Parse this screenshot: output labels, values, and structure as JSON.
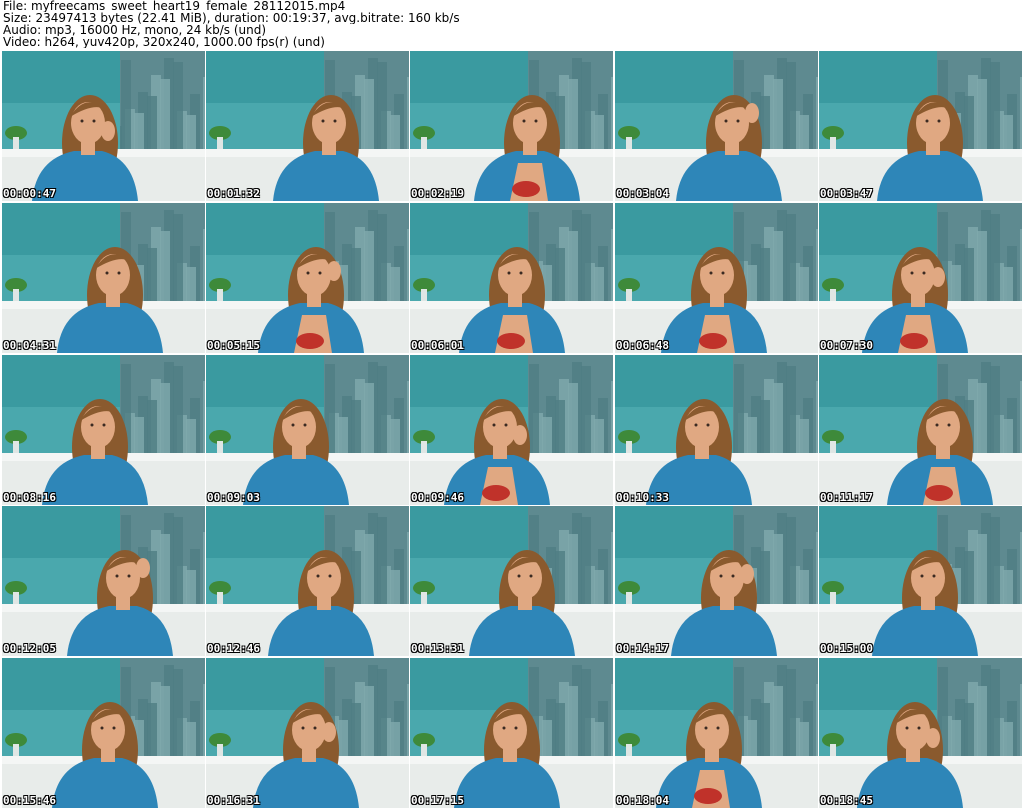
{
  "header": {
    "file_line": "File: myfreecams_sweet_heart19_female_28112015.mp4",
    "size_line": "Size: 23497413 bytes (22.41 MiB), duration: 00:19:37, avg.bitrate: 160 kb/s",
    "audio_line": "Audio: mp3, 16000 Hz, mono, 24 kb/s (und)",
    "video_line": "Video: h264, yuv420p, 320x240, 1000.00 fps(r) (und)"
  },
  "thumbnails": [
    {
      "timestamp": "00:00:47"
    },
    {
      "timestamp": "00:01:32"
    },
    {
      "timestamp": "00:02:19"
    },
    {
      "timestamp": "00:03:04"
    },
    {
      "timestamp": "00:03:47"
    },
    {
      "timestamp": "00:04:31"
    },
    {
      "timestamp": "00:05:15"
    },
    {
      "timestamp": "00:06:01"
    },
    {
      "timestamp": "00:06:48"
    },
    {
      "timestamp": "00:07:30"
    },
    {
      "timestamp": "00:08:16"
    },
    {
      "timestamp": "00:09:03"
    },
    {
      "timestamp": "00:09:46"
    },
    {
      "timestamp": "00:10:33"
    },
    {
      "timestamp": "00:11:17"
    },
    {
      "timestamp": "00:12:05"
    },
    {
      "timestamp": "00:12:46"
    },
    {
      "timestamp": "00:13:31"
    },
    {
      "timestamp": "00:14:17"
    },
    {
      "timestamp": "00:15:00"
    },
    {
      "timestamp": "00:15:46"
    },
    {
      "timestamp": "00:16:31"
    },
    {
      "timestamp": "00:17:15"
    },
    {
      "timestamp": "00:18:04"
    },
    {
      "timestamp": "00:18:45"
    }
  ],
  "colors": {
    "wall_teal": "#3a9aa0",
    "city_mural": "#5e8a90",
    "couch": "#e8ecea",
    "jacket": "#2e86b8",
    "hair": "#8a5a2e",
    "skin": "#e0a882",
    "red_top": "#c0322a"
  }
}
